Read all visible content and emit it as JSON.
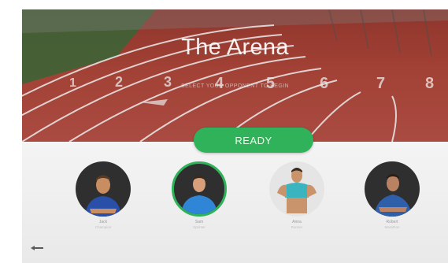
{
  "arena": {
    "title": "The Arena",
    "subtitle": "SELECT YOUR OPPONENT TO BEGIN"
  },
  "ready_label": "READY",
  "players": [
    {
      "name": "Jack",
      "desc": "Champion",
      "shirt": "#2a4fa8",
      "selected": false,
      "bg": "dark"
    },
    {
      "name": "Sam",
      "desc": "Sprinter",
      "shirt": "#2f86d6",
      "selected": true,
      "bg": "dark"
    },
    {
      "name": "Anna",
      "desc": "Runner",
      "shirt": "#3ab5c0",
      "selected": false,
      "bg": "light"
    },
    {
      "name": "Robert",
      "desc": "Marathon",
      "shirt": "#2f5fa8",
      "selected": false,
      "bg": "dark"
    }
  ],
  "icons": {
    "back": "back-arrow-icon"
  },
  "colors": {
    "accent": "#2fb25a",
    "track": "#b0473a"
  }
}
